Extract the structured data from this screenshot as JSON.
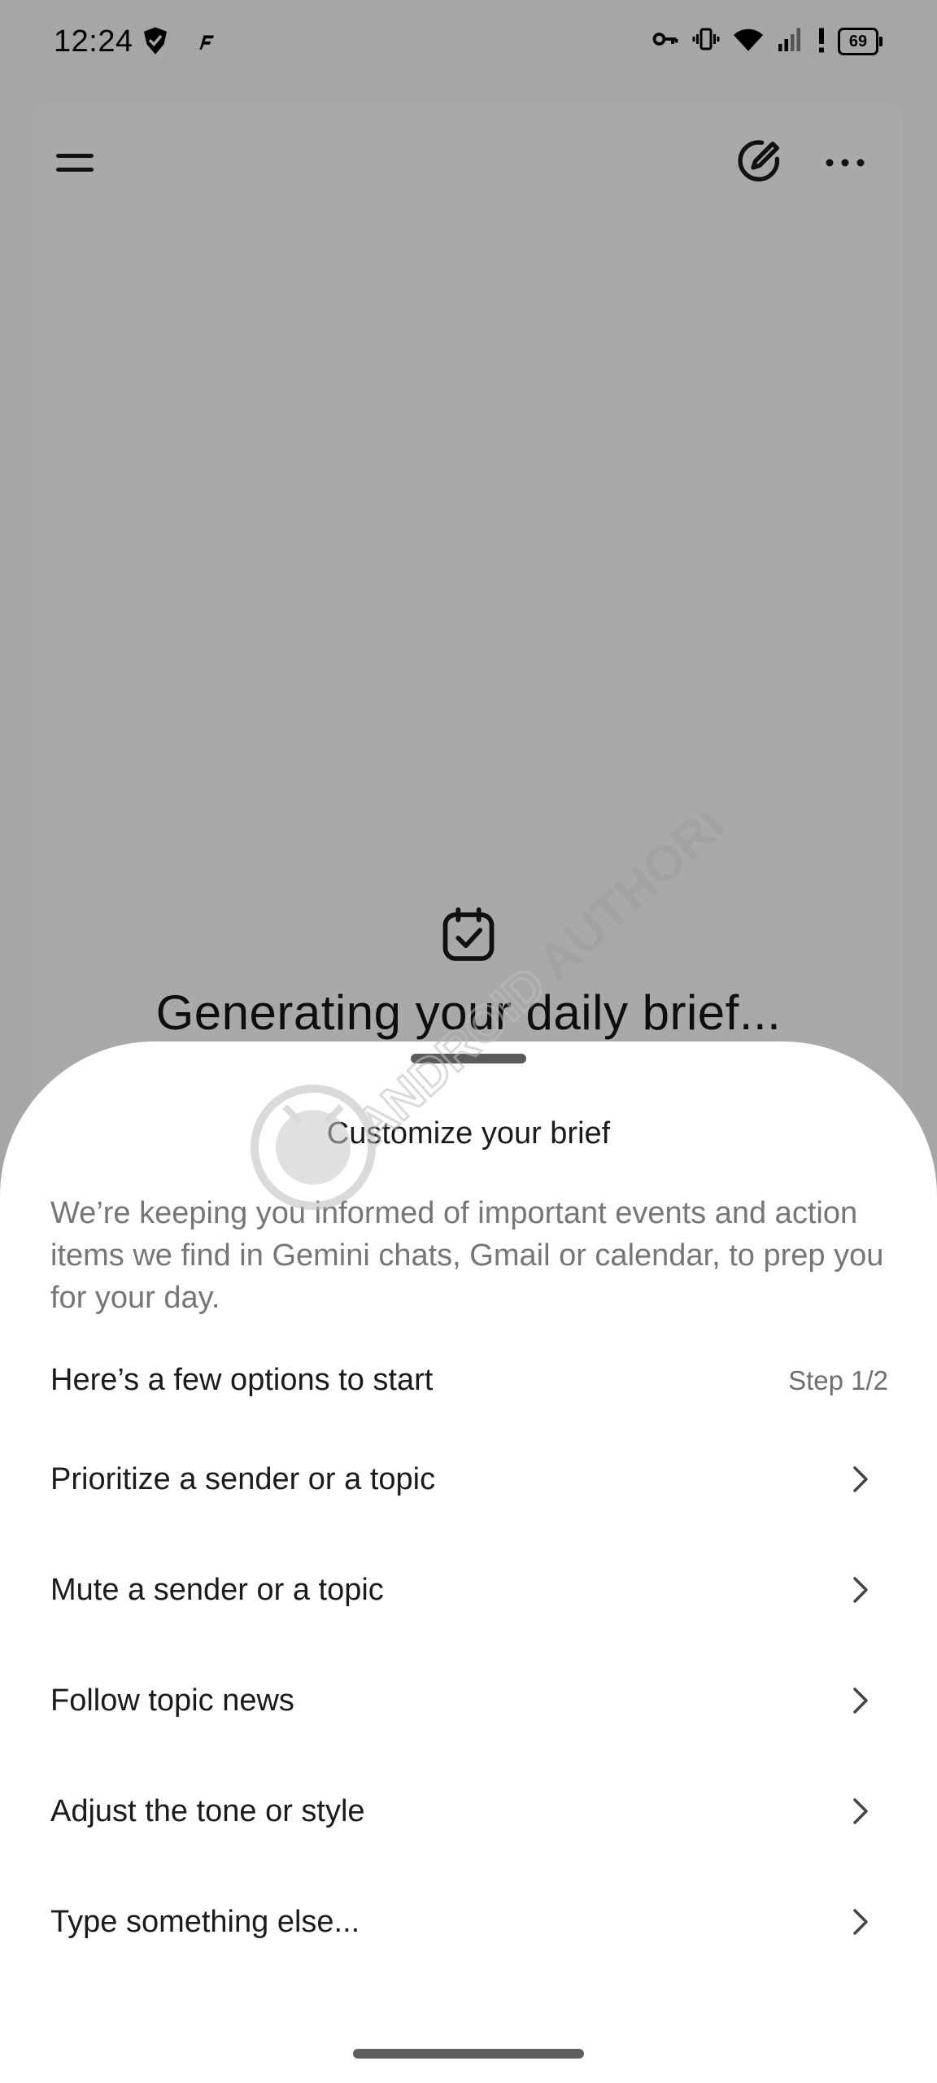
{
  "status_bar": {
    "time": "12:24",
    "battery_level": "69",
    "left_icons": [
      "shield-check-icon",
      "app-notification-icon"
    ],
    "right_icons": [
      "vpn-key-icon",
      "vibrate-icon",
      "wifi-icon",
      "signal-icon",
      "alert-icon",
      "battery-icon"
    ]
  },
  "toolbar": {
    "menu_icon": "hamburger-menu-icon",
    "edit_icon": "new-chat-edit-icon",
    "more_icon": "more-options-icon"
  },
  "background": {
    "icon": "calendar-check-icon",
    "title": "Generating your daily brief..."
  },
  "sheet": {
    "title": "Customize your brief",
    "description": "We’re keeping you informed of important events and action items we find in Gemini chats, Gmail or calendar, to prep you for your day.",
    "options_label": "Here’s a few options to start",
    "step_label": "Step 1/2",
    "options": [
      {
        "label": "Prioritize a sender or a topic"
      },
      {
        "label": "Mute a sender or a topic"
      },
      {
        "label": "Follow topic news"
      },
      {
        "label": "Adjust the tone or style"
      },
      {
        "label": "Type something else..."
      }
    ]
  },
  "watermark": {
    "text": "ANDROID AUTHORITY"
  },
  "colors": {
    "scrim": "#a6a6a6",
    "sheet_background": "#ffffff",
    "primary_text": "#1b1b1b",
    "secondary_text": "#767676"
  }
}
